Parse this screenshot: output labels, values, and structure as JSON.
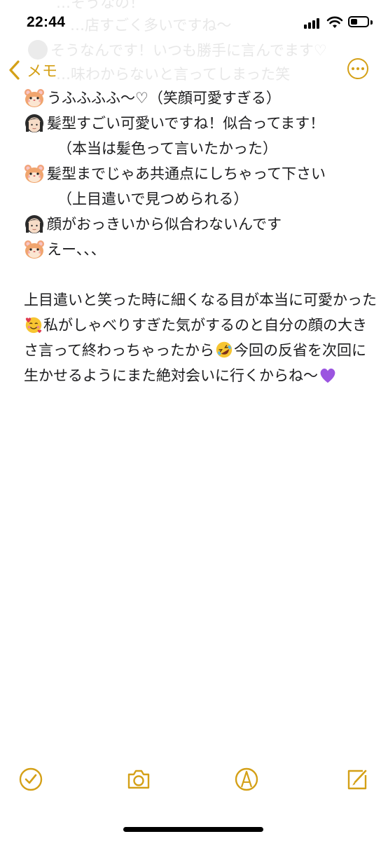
{
  "status_bar": {
    "time": "22:44"
  },
  "nav": {
    "back_label": "メモ"
  },
  "ghost_lines": [
    "…そうなの！",
    "…店すごく多いですね〜",
    "そうなんです！いつも勝手に言んでます♡",
    "…味わからないと言ってしまった笑"
  ],
  "note": {
    "lines": [
      {
        "speaker": "hamster",
        "text": "うふふふふ〜♡（笑顔可愛すぎる）"
      },
      {
        "speaker": "woman",
        "text": "髪型すごい可愛いですね！似合ってます！"
      },
      {
        "speaker": "none",
        "text": "（本当は髪色って言いたかった）"
      },
      {
        "speaker": "hamster",
        "text": "髪型までじゃあ共通点にしちゃって下さい"
      },
      {
        "speaker": "none",
        "text": "（上目遣いで見つめられる）"
      },
      {
        "speaker": "woman",
        "text": "顔がおっきいから似合わないんです"
      },
      {
        "speaker": "hamster",
        "text": "えー、、、"
      }
    ],
    "paragraph": {
      "part1": "上目遣いと笑った時に細くなる目が本当に可愛かった",
      "part2": "私がしゃべりすぎた気がするのと自分の顔の大きさ言って終わっちゃったから",
      "part3": "今回の反省を次回に生かせるようにまた絶対会いに行くからね〜"
    }
  },
  "icons": {
    "accent": "#d4a017",
    "toolbar": [
      "checklist-icon",
      "camera-icon",
      "markup-icon",
      "compose-icon"
    ]
  }
}
